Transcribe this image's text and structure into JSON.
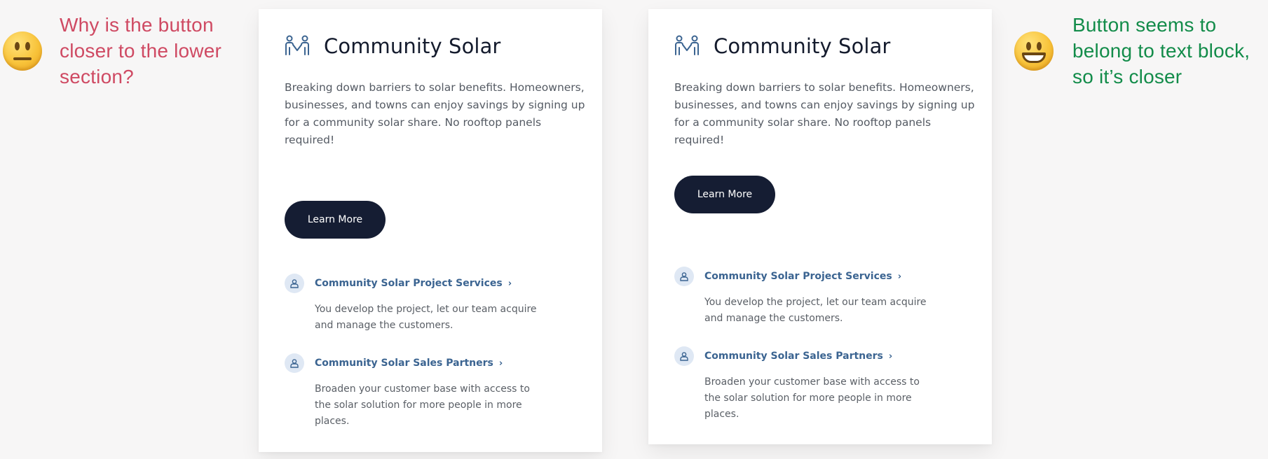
{
  "annotations": {
    "left": "Why is the button closer to the lower section?",
    "right": "Button seems to belong to text block, so it’s closer"
  },
  "emojis": {
    "left": "neutral-face-emoji",
    "right": "smiling-face-emoji"
  },
  "colors": {
    "left_note": "#cf4a63",
    "right_note": "#138c4a",
    "button_bg": "#151d33",
    "link": "#3b6491",
    "title": "#141b2d"
  },
  "cards": [
    {
      "title": "Community Solar",
      "description": "Breaking down barriers to solar benefits. Homeowners, businesses, and towns can enjoy savings by signing up for a community solar share. No rooftop panels required!",
      "button_label": "Learn More",
      "links": [
        {
          "title": "Community Solar Project Services",
          "description": "You develop the project, let our team acquire and manage the customers."
        },
        {
          "title": "Community Solar Sales Partners",
          "description": "Broaden your customer base with access to the solar solution for more people in more places."
        }
      ]
    },
    {
      "title": "Community Solar",
      "description": "Breaking down barriers to solar benefits. Homeowners, businesses, and towns can enjoy savings by signing up for a community solar share. No rooftop panels required!",
      "button_label": "Learn More",
      "links": [
        {
          "title": "Community Solar Project Services",
          "description": "You develop the project, let our team acquire and manage the customers."
        },
        {
          "title": "Community Solar Sales Partners",
          "description": "Broaden your customer base with access to the solar solution for more people in more places."
        }
      ]
    }
  ]
}
